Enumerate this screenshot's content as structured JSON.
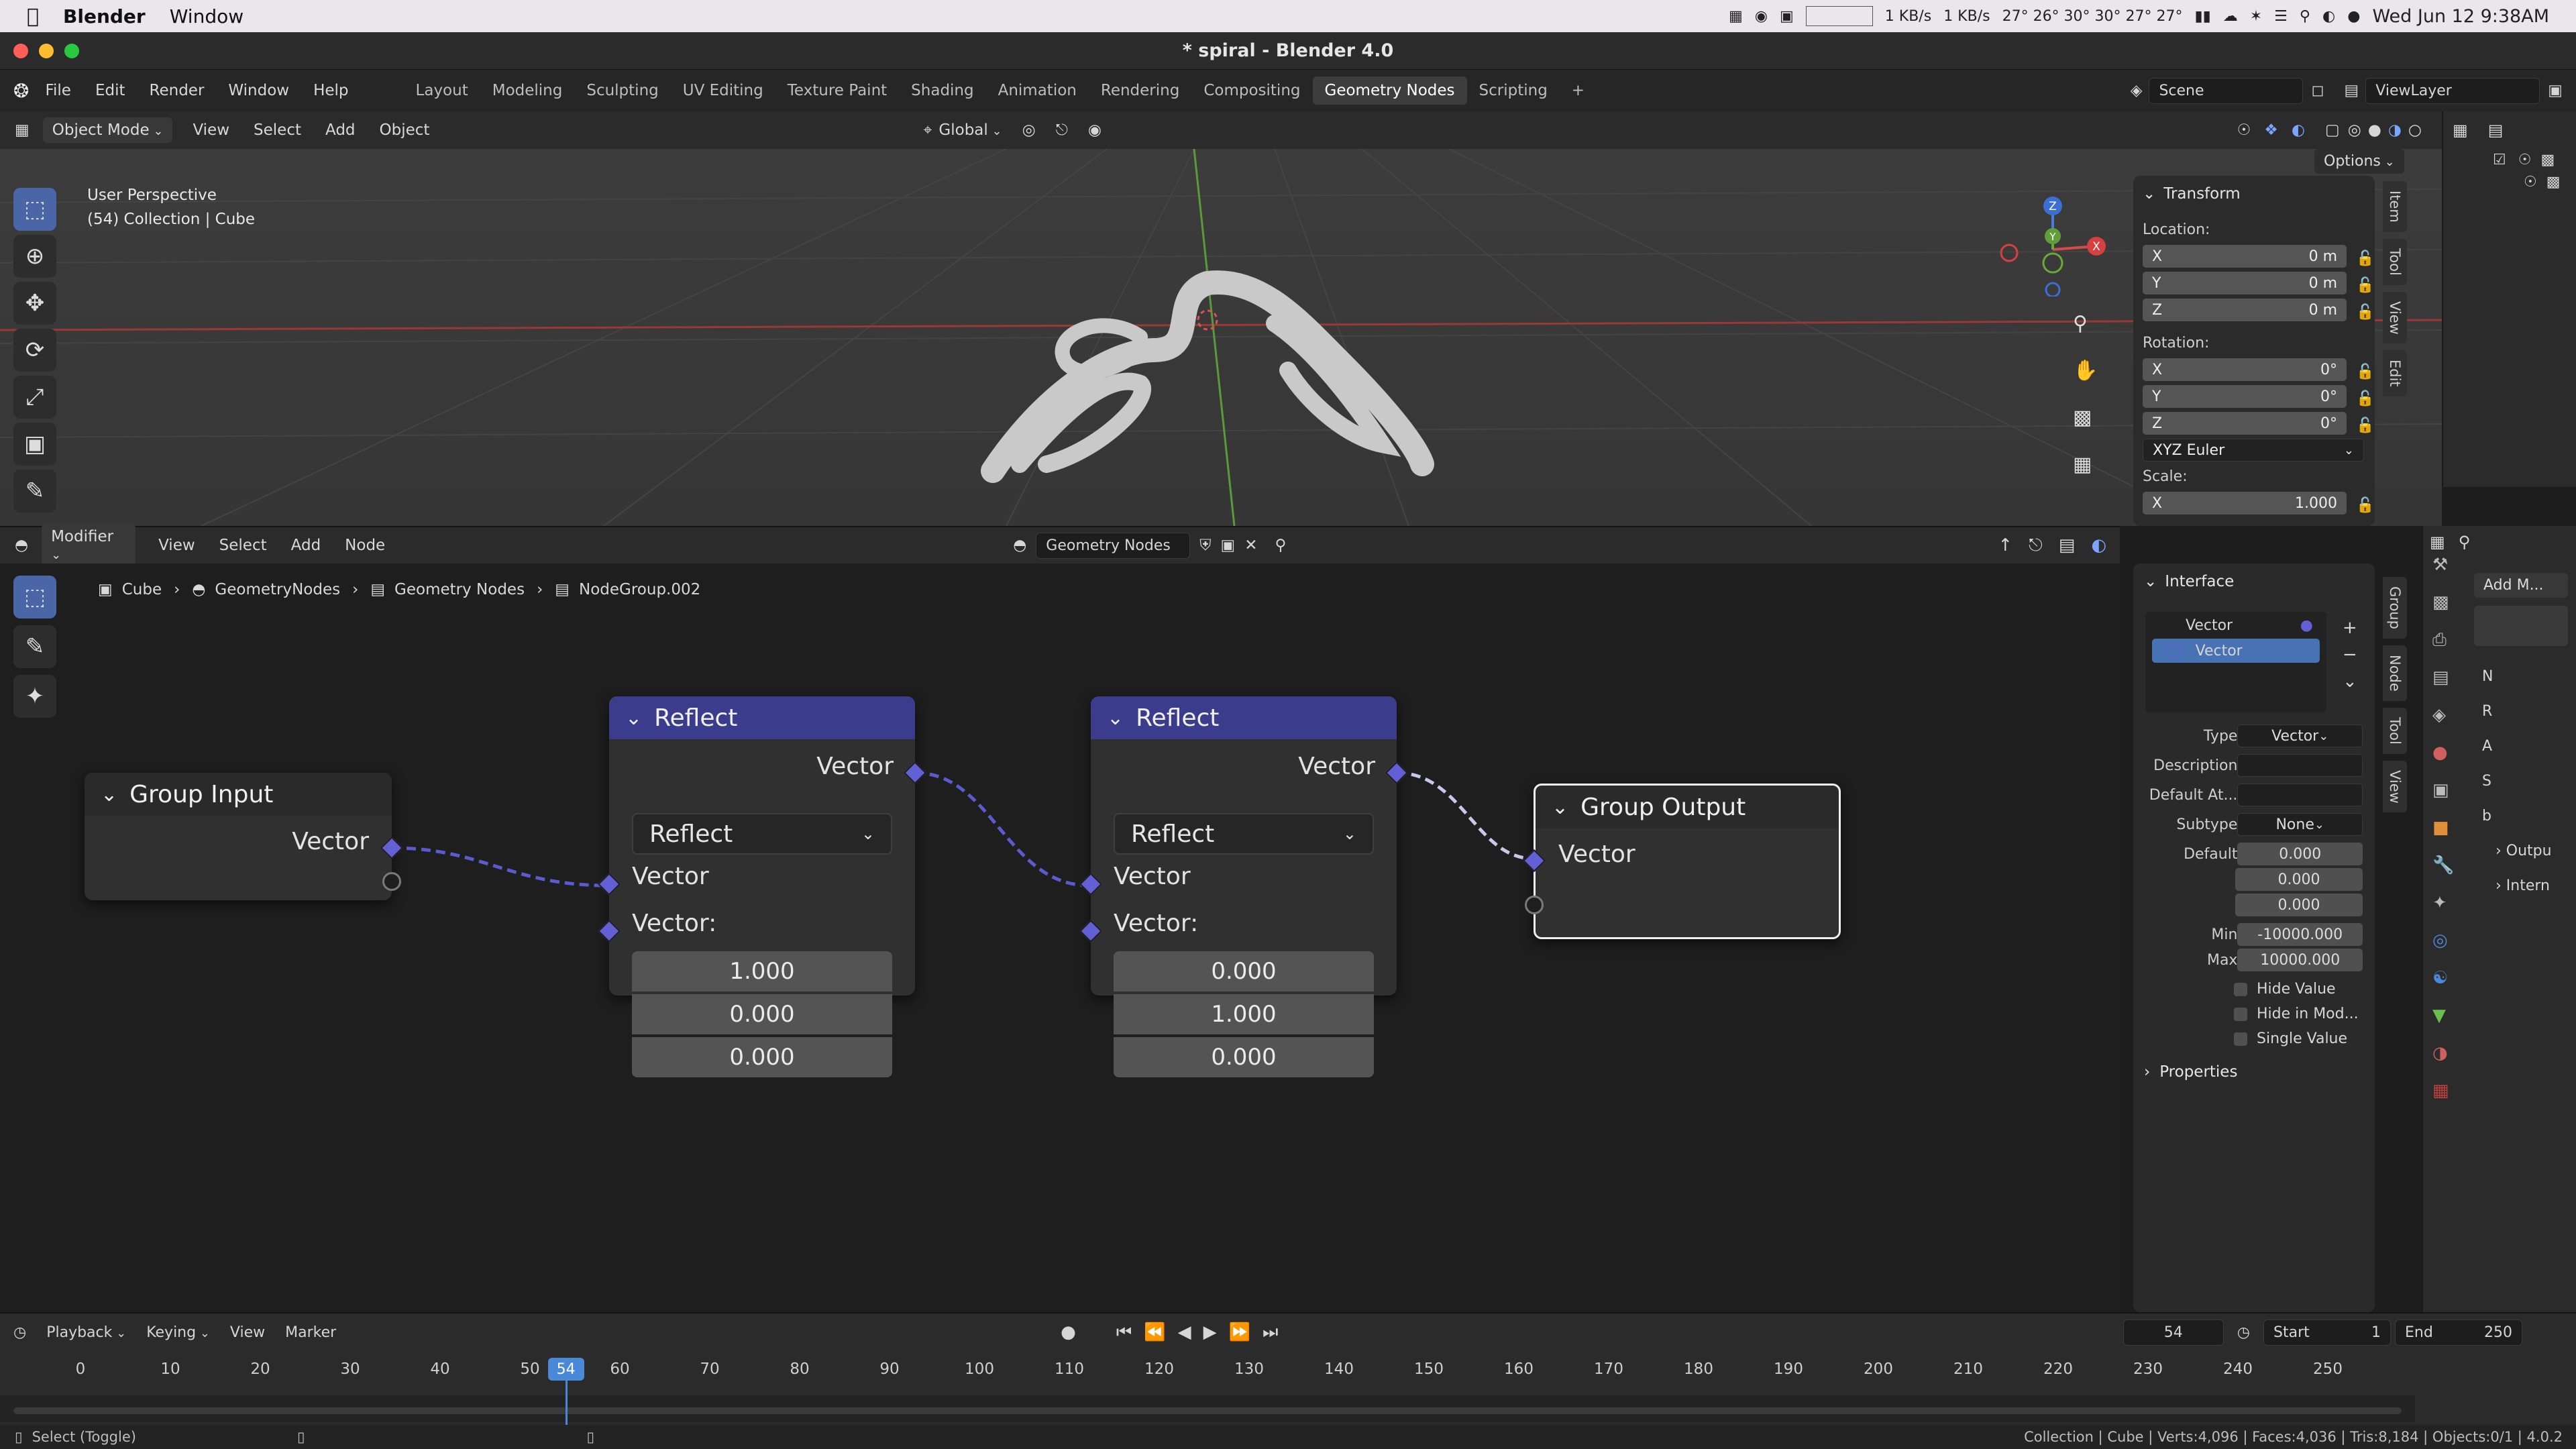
{
  "menubar": {
    "app": "Blender",
    "items": [
      "Window"
    ],
    "tray": {
      "net_up": "1 KB/s",
      "net_down": "1 KB/s",
      "temps": "27° 26° 30° 30° 27° 27°",
      "datetime": "Wed Jun 12  9:38AM"
    }
  },
  "window": {
    "title": "* spiral - Blender 4.0"
  },
  "topbar": {
    "menus": [
      "File",
      "Edit",
      "Render",
      "Window",
      "Help"
    ],
    "workspaces": [
      "Layout",
      "Modeling",
      "Sculpting",
      "UV Editing",
      "Texture Paint",
      "Shading",
      "Animation",
      "Rendering",
      "Compositing",
      "Geometry Nodes",
      "Scripting"
    ],
    "active_workspace": "Geometry Nodes",
    "add_tab": "+",
    "scene": "Scene",
    "view_layer": "ViewLayer"
  },
  "viewport_header": {
    "mode": "Object Mode",
    "menus": [
      "View",
      "Select",
      "Add",
      "Object"
    ],
    "orientation": "Global",
    "options": "Options"
  },
  "viewport": {
    "perspective": "User Perspective",
    "collection": "(54) Collection | Cube",
    "axes": {
      "x": "X",
      "y": "Y",
      "z": "Z"
    }
  },
  "npanel": {
    "section": "Transform",
    "location_label": "Location:",
    "location": [
      {
        "axis": "X",
        "value": "0 m"
      },
      {
        "axis": "Y",
        "value": "0 m"
      },
      {
        "axis": "Z",
        "value": "0 m"
      }
    ],
    "rotation_label": "Rotation:",
    "rotation": [
      {
        "axis": "X",
        "value": "0°"
      },
      {
        "axis": "Y",
        "value": "0°"
      },
      {
        "axis": "Z",
        "value": "0°"
      }
    ],
    "rotation_mode": "XYZ Euler",
    "scale_label": "Scale:",
    "scale": [
      {
        "axis": "X",
        "value": "1.000"
      }
    ],
    "tabs": [
      "Item",
      "Tool",
      "View",
      "Edit"
    ]
  },
  "node_header": {
    "editor": "Modifier",
    "menus": [
      "View",
      "Select",
      "Add",
      "Node"
    ],
    "tree_name": "Geometry Nodes"
  },
  "breadcrumb": [
    "Cube",
    "GeometryNodes",
    "Geometry Nodes",
    "NodeGroup.002"
  ],
  "nodes": {
    "group_input": {
      "title": "Group Input",
      "output": "Vector"
    },
    "reflect1": {
      "title": "Reflect",
      "output": "Vector",
      "mode": "Reflect",
      "input_vector": "Vector",
      "input_label": "Vector:",
      "values": [
        "1.000",
        "0.000",
        "0.000"
      ]
    },
    "reflect2": {
      "title": "Reflect",
      "output": "Vector",
      "mode": "Reflect",
      "input_vector": "Vector",
      "input_label": "Vector:",
      "values": [
        "0.000",
        "1.000",
        "0.000"
      ]
    },
    "group_output": {
      "title": "Group Output",
      "input": "Vector"
    }
  },
  "interface": {
    "section": "Interface",
    "items": [
      "Vector",
      "Vector"
    ],
    "type_label": "Type",
    "type_value": "Vector",
    "description_label": "Description",
    "default_attr_label": "Default At...",
    "subtype_label": "Subtype",
    "subtype_value": "None",
    "default_label": "Default",
    "defaults": [
      "0.000",
      "0.000",
      "0.000"
    ],
    "min_label": "Min",
    "min_value": "-10000.000",
    "max_label": "Max",
    "max_value": "10000.000",
    "checks": [
      "Hide Value",
      "Hide in Mod...",
      "Single Value"
    ],
    "properties": "Properties",
    "tabs": [
      "Group",
      "Node",
      "Tool",
      "View"
    ]
  },
  "propcol": {
    "add_modifier": "Add M...",
    "letters": [
      "N",
      "R",
      "A",
      "S",
      "b"
    ],
    "output": "Outpu",
    "internal": "Intern"
  },
  "timeline": {
    "menus": [
      "Playback",
      "Keying",
      "View",
      "Marker"
    ],
    "current_frame": "54",
    "start_label": "Start",
    "start": "1",
    "end_label": "End",
    "end": "250",
    "ticks": [
      "0",
      "10",
      "20",
      "30",
      "40",
      "50",
      "60",
      "70",
      "80",
      "90",
      "100",
      "110",
      "120",
      "130",
      "140",
      "150",
      "160",
      "170",
      "180",
      "190",
      "200",
      "210",
      "220",
      "230",
      "240",
      "250"
    ]
  },
  "statusbar": {
    "left": "Select (Toggle)",
    "right": "Collection | Cube | Verts:4,096 | Faces:4,036 | Tris:8,184 | Objects:0/1 | 4.0.2"
  }
}
